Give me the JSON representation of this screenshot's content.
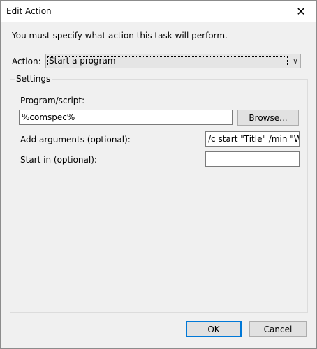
{
  "window": {
    "title": "Edit Action"
  },
  "intro_text": "You must specify what action this task will perform.",
  "action": {
    "label": "Action:",
    "selected": "Start a program"
  },
  "settings": {
    "group_label": "Settings",
    "program_label": "Program/script:",
    "program_value": "%comspec%",
    "browse_label": "Browse...",
    "arguments_label": "Add arguments (optional):",
    "arguments_value": "/c start \"Title\" /min \"W:\\",
    "start_in_label": "Start in (optional):",
    "start_in_value": ""
  },
  "buttons": {
    "ok": "OK",
    "cancel": "Cancel"
  }
}
